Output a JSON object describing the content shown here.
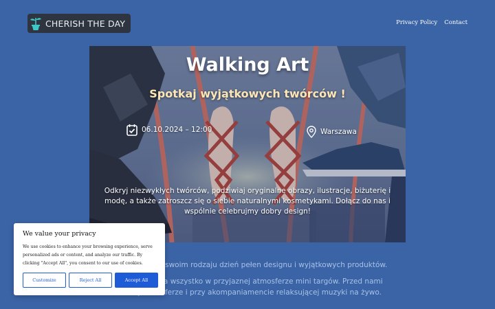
{
  "header": {
    "logo_text": "CHERISH THE DAY",
    "nav": [
      {
        "label": "Privacy Policy"
      },
      {
        "label": "Contact"
      }
    ]
  },
  "hero": {
    "title": "Walking Art",
    "subtitle": "Spotkaj wyjątkowych twórców !",
    "date_time": "06.10.2024 – 12:00",
    "location": "Warszawa",
    "description": "Odkryj niezwykłych twórców, podziwiaj oryginalne obrazy, ilustracje, biżuterię i modę, a także zatroszcz się o siebie naturalnymi kosmetykami. Dołącz do nas i wspólnie celebrujmy dobry design!",
    "icons": {
      "date": "calendar-check-icon",
      "location": "map-pin-icon"
    }
  },
  "body": {
    "paragraph_1": "edyny w swoim rodzaju dzień pełen designu i wyjątkowych produktów.",
    "paragraph_2_line_1": "piracji, a wszystko w przyjaznej atmosferze mini targów. Przed nami",
    "paragraph_2_line_2": "j atmosferze i przy akompaniamencie relaksującej muzyki na żywo."
  },
  "cookie_banner": {
    "title": "We value your privacy",
    "text": "We use cookies to enhance your browsing experience, serve personalized ads or content, and analyze our traffic. By clicking \"Accept All\", you consent to our use of cookies.",
    "buttons": {
      "customize": "Customize",
      "reject": "Reject All",
      "accept": "Accept All"
    }
  },
  "colors": {
    "page_background": "#3b64a6",
    "accent_button": "#1e5bd6",
    "subtitle": "#fde6b6"
  }
}
